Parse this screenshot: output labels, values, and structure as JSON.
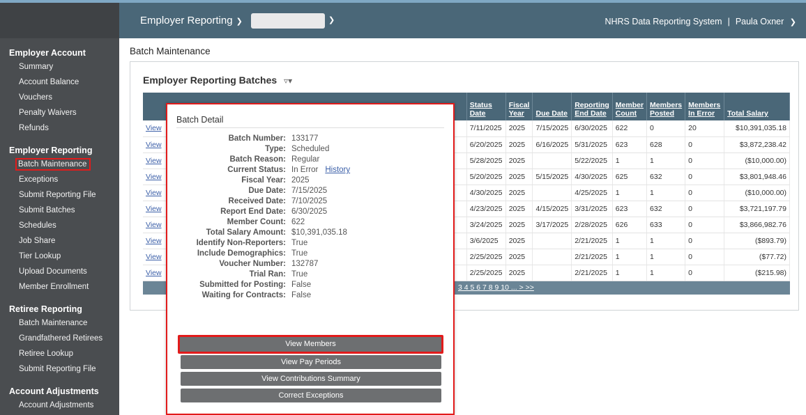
{
  "topbar": {
    "app_menu": "Employer Reporting",
    "system_name": "NHRS Data Reporting System",
    "separator": "|",
    "user_name": "Paula Oxner"
  },
  "sidebar": {
    "sections": [
      {
        "title": "Employer Account",
        "items": [
          "Summary",
          "Account Balance",
          "Vouchers",
          "Penalty Waivers",
          "Refunds"
        ]
      },
      {
        "title": "Employer Reporting",
        "items": [
          "Batch Maintenance",
          "Exceptions",
          "Submit Reporting File",
          "Submit Batches",
          "Schedules",
          "Job Share",
          "Tier Lookup",
          "Upload Documents",
          "Member Enrollment"
        ]
      },
      {
        "title": "Retiree Reporting",
        "items": [
          "Batch Maintenance",
          "Grandfathered Retirees",
          "Retiree Lookup",
          "Submit Reporting File"
        ]
      },
      {
        "title": "Account Adjustments",
        "items": [
          "Account Adjustments"
        ]
      }
    ]
  },
  "main": {
    "page_title": "Batch Maintenance",
    "panel_title": "Employer Reporting Batches",
    "filter_icon": "filter-icon",
    "columns": [
      "Status Date",
      "Fiscal Year",
      "Due Date",
      "Reporting End Date",
      "Member Count",
      "Members Posted",
      "Members In Error",
      "Total Salary"
    ],
    "view_label": "View",
    "rows": [
      [
        "7/11/2025",
        "2025",
        "7/15/2025",
        "6/30/2025",
        "622",
        "0",
        "20",
        "$10,391,035.18"
      ],
      [
        "6/20/2025",
        "2025",
        "6/16/2025",
        "5/31/2025",
        "623",
        "628",
        "0",
        "$3,872,238.42"
      ],
      [
        "5/28/2025",
        "2025",
        "",
        "5/22/2025",
        "1",
        "1",
        "0",
        "($10,000.00)"
      ],
      [
        "5/20/2025",
        "2025",
        "5/15/2025",
        "4/30/2025",
        "625",
        "632",
        "0",
        "$3,801,948.46"
      ],
      [
        "4/30/2025",
        "2025",
        "",
        "4/25/2025",
        "1",
        "1",
        "0",
        "($10,000.00)"
      ],
      [
        "4/23/2025",
        "2025",
        "4/15/2025",
        "3/31/2025",
        "623",
        "632",
        "0",
        "$3,721,197.79"
      ],
      [
        "3/24/2025",
        "2025",
        "3/17/2025",
        "2/28/2025",
        "626",
        "633",
        "0",
        "$3,866,982.76"
      ],
      [
        "3/6/2025",
        "2025",
        "",
        "2/21/2025",
        "1",
        "1",
        "0",
        "($893.79)"
      ],
      [
        "2/25/2025",
        "2025",
        "",
        "2/21/2025",
        "1",
        "1",
        "0",
        "($77.72)"
      ],
      [
        "2/25/2025",
        "2025",
        "",
        "2/21/2025",
        "1",
        "1",
        "0",
        "($215.98)"
      ]
    ],
    "pager": "3 4 5 6 7 8 9 10 ... > >>"
  },
  "popup": {
    "title": "Batch Detail",
    "history_link": "History",
    "fields": [
      {
        "label": "Batch Number:",
        "value": "133177"
      },
      {
        "label": "Type:",
        "value": "Scheduled"
      },
      {
        "label": "Batch Reason:",
        "value": "Regular"
      },
      {
        "label": "Current Status:",
        "value": "In Error"
      },
      {
        "label": "Fiscal Year:",
        "value": "2025"
      },
      {
        "label": "Due Date:",
        "value": "7/15/2025"
      },
      {
        "label": "Received Date:",
        "value": "7/10/2025"
      },
      {
        "label": "Report End Date:",
        "value": "6/30/2025"
      },
      {
        "label": "Member Count:",
        "value": "622"
      },
      {
        "label": "Total Salary Amount:",
        "value": "$10,391,035.18"
      },
      {
        "label": "Identify Non-Reporters:",
        "value": "True"
      },
      {
        "label": "Include Demographics:",
        "value": "True"
      },
      {
        "label": "Voucher Number:",
        "value": "132787"
      },
      {
        "label": "Trial Ran:",
        "value": "True"
      },
      {
        "label": "Submitted for Posting:",
        "value": "False"
      },
      {
        "label": "Waiting for Contracts:",
        "value": "False"
      }
    ],
    "buttons": [
      "View Members",
      "View Pay Periods",
      "View Contributions Summary",
      "Correct Exceptions"
    ]
  }
}
